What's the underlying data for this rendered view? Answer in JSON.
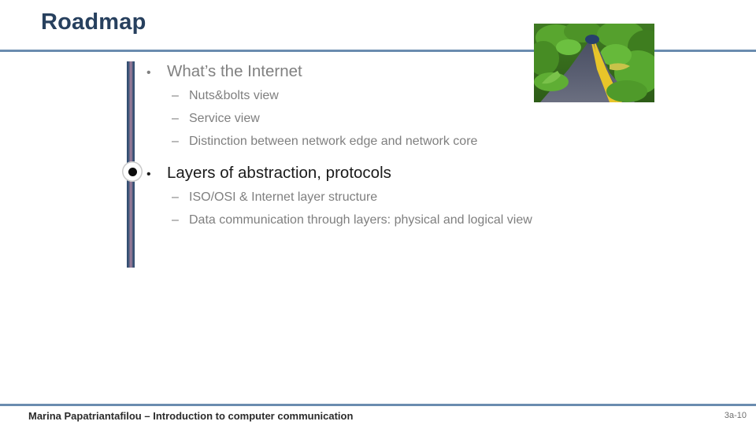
{
  "slide": {
    "title": "Roadmap",
    "accent_color": "#6a8caf",
    "title_color": "#27405e",
    "background_color": "#ffffff"
  },
  "header": {
    "rule_color": "#6a8caf"
  },
  "media": {
    "road_photo_alt": "Winding two-lane country road lined with green trees, yellow double center line"
  },
  "progress": {
    "bar_colors": [
      "#2f4a6d",
      "#9b7f9c"
    ],
    "marker_label": "current-topic-marker"
  },
  "outline": {
    "groups": [
      {
        "heading": "What’s the Internet",
        "bullet_glyph": "•",
        "current": false,
        "text_color": "#808080",
        "items": [
          {
            "dash_glyph": "–",
            "text": "Nuts&bolts view"
          },
          {
            "dash_glyph": "–",
            "text": "Service view"
          },
          {
            "dash_glyph": "–",
            "text": "Distinction between network edge and network core"
          }
        ]
      },
      {
        "heading": "Layers of abstraction, protocols",
        "bullet_glyph": "•",
        "current": true,
        "text_color": "#1a1a1a",
        "items": [
          {
            "dash_glyph": "–",
            "text": "ISO/OSI & Internet layer structure"
          },
          {
            "dash_glyph": "–",
            "text": "Data communication through layers: physical and logical view"
          }
        ]
      }
    ]
  },
  "footer": {
    "rule_color": "#6a8caf",
    "text": "Marina Papatriantafilou –  Introduction to computer communication",
    "page_number": "3a-10"
  }
}
